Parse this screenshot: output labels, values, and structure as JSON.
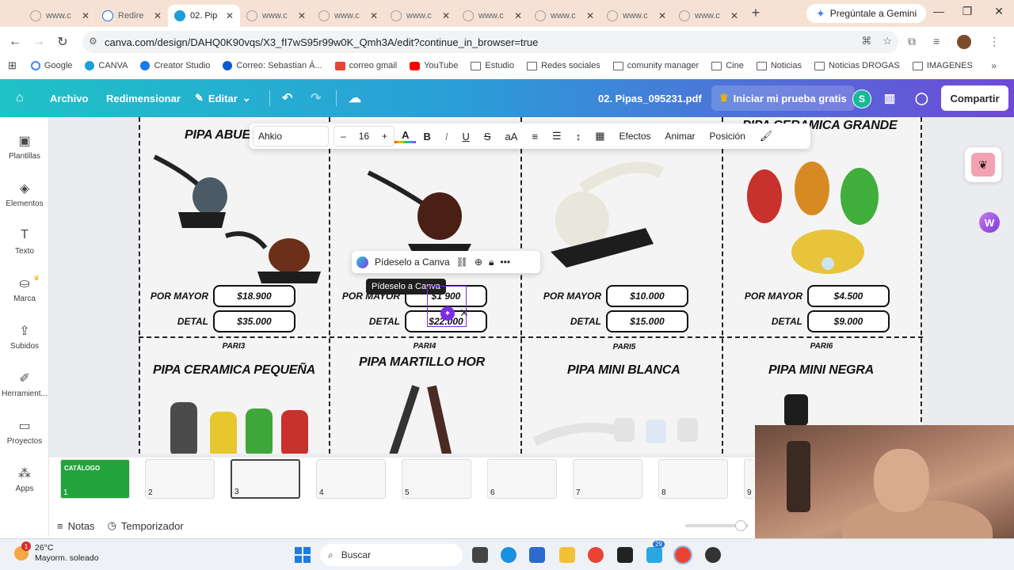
{
  "browser": {
    "tabs": [
      {
        "title": "www.c"
      },
      {
        "title": "Redire"
      },
      {
        "title": "02. Pip"
      },
      {
        "title": "www.c"
      },
      {
        "title": "www.c"
      },
      {
        "title": "www.c"
      },
      {
        "title": "www.c"
      },
      {
        "title": "www.c"
      },
      {
        "title": "www.c"
      },
      {
        "title": "www.c"
      }
    ],
    "new_tab": "+",
    "gemini": "Pregúntale a Gemini",
    "url": "canva.com/design/DAHQ0K90vqs/X3_fI7wS95r99w0K_Qmh3A/edit?continue_in_browser=true",
    "bookmarks": [
      "Google",
      "CANVA",
      "Creator Studio",
      "Correo: Sebastian Á...",
      "correo gmail",
      "YouTube",
      "Estudio",
      "Redes sociales",
      "comunity manager",
      "Cine",
      "Noticias",
      "Noticias DROGAS",
      "IMAGENES"
    ]
  },
  "canva": {
    "menu": {
      "archivo": "Archivo",
      "redimensionar": "Redimensionar",
      "editar": "Editar"
    },
    "doc_title": "02. Pipas_095231.pdf",
    "trial": "Iniciar mi prueba gratis",
    "avatar": "S",
    "share": "Compartir",
    "rail": [
      "Plantillas",
      "Elementos",
      "Texto",
      "Marca",
      "Subidos",
      "Herramient...",
      "Proyectos",
      "Apps"
    ],
    "toolbar": {
      "font": "Ahkio",
      "minus": "–",
      "size": "16",
      "plus": "+",
      "case": "aA",
      "effects": "Efectos",
      "animate": "Animar",
      "position": "Posición"
    },
    "ask": {
      "label": "Pídeselo a Canva",
      "tooltip": "Pídeselo a Canva"
    },
    "footer": {
      "notes": "Notas",
      "timer": "Temporizador"
    },
    "thumb_numbers": [
      "1",
      "2",
      "3",
      "4",
      "5",
      "6",
      "7",
      "8",
      "9"
    ],
    "thumb1_title": "CATÁLOGO"
  },
  "catalog": {
    "labels": {
      "mayor": "POR MAYOR",
      "detal": "DETAL"
    },
    "top_row": [
      {
        "title": "PIPA ABUE",
        "mayor": "$18.900",
        "detal": "$35.000"
      },
      {
        "title": "",
        "mayor": "$1 900",
        "detal": "$22.000"
      },
      {
        "title": "",
        "mayor": "$10.000",
        "detal": "$15.000"
      },
      {
        "title": "PIPA CERAMICA GRANDE",
        "mayor": "$4.500",
        "detal": "$9.000"
      }
    ],
    "bottom_row": [
      {
        "code": "PARI3",
        "title": "PIPA CERAMICA PEQUEÑA"
      },
      {
        "code": "PARI4",
        "title": "PIPA MARTILLO HOR"
      },
      {
        "code": "PARI5",
        "title": "PIPA MINI BLANCA"
      },
      {
        "code": "PARI6",
        "title": "PIPA MINI NEGRA"
      }
    ]
  },
  "taskbar": {
    "temp": "26°C",
    "weather": "Mayorm. soleado",
    "weather_badge": "1",
    "search": "Buscar",
    "badge": "29"
  }
}
